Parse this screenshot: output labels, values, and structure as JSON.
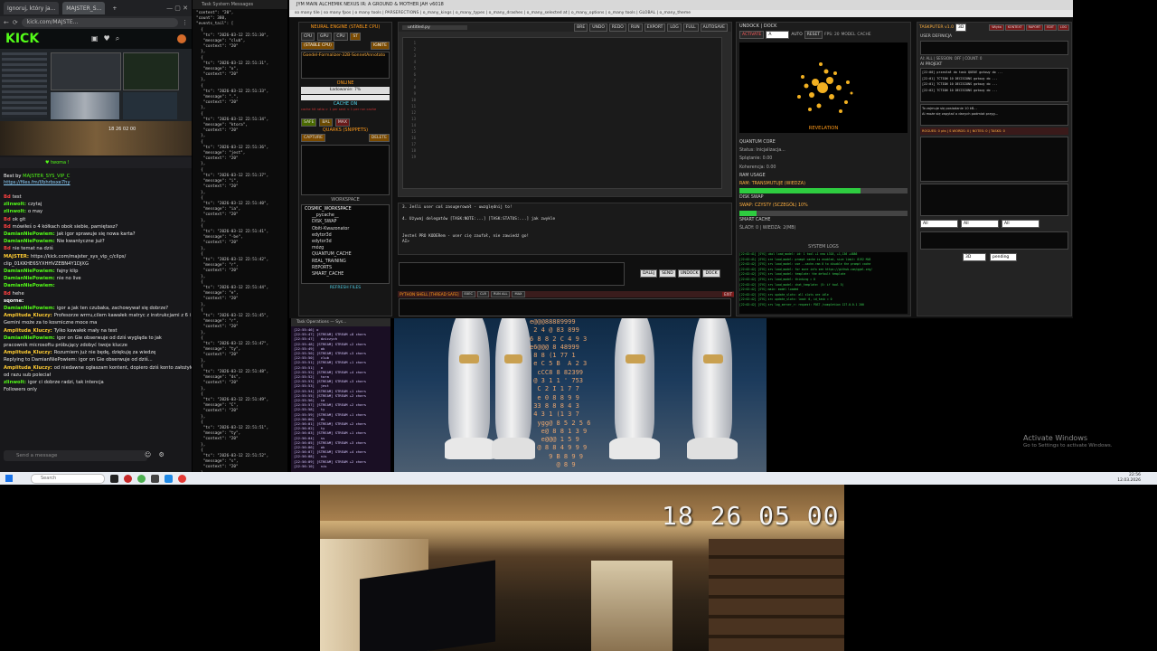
{
  "browser": {
    "tabs": [
      "Ignoruj, który ja...",
      "MAJSTER_S...",
      "+"
    ],
    "url": "kick.com/MAJSTE...",
    "logo": "KICK",
    "stream_timer": "18 26 02 00",
    "banner_user": "MAJSTER_SYS_VIP_C",
    "banner_link": "https://files.fm/f/bhrbsxe7hy",
    "chat_messages": [
      {
        "user": "Bd",
        "text": "test",
        "cls": "u2"
      },
      {
        "user": "zlinwolt:",
        "text": "czytaj",
        "cls": "u1"
      },
      {
        "user": "zlinwolt:",
        "text": "o may",
        "cls": "u1"
      },
      {
        "user": "Bd",
        "text": "ok git",
        "cls": "u2"
      },
      {
        "user": "Bd",
        "text": "mówiłeś o 4 kółkach obok siebie, pamiętasz?",
        "cls": "u2"
      },
      {
        "user": "DamianNiePowiem:",
        "text": "jak igor sprawuje się nowa karta?",
        "cls": "u1"
      },
      {
        "user": "DamianNiePowiem:",
        "text": "Nie kwantyczne już?",
        "cls": "u1"
      },
      {
        "user": "Bd",
        "text": "nie temat na dziś",
        "cls": "u2"
      },
      {
        "user": "MAJSTER:",
        "text": "https://kick.com/majster_sys_vip_c/clips/",
        "cls": "u3"
      },
      {
        "user": "",
        "text": "clip_01KKHE6SYXHHVZEBN4Y1DJXG",
        "cls": "u4"
      },
      {
        "user": "DamianNiePowiem:",
        "text": "fajny klip",
        "cls": "u1"
      },
      {
        "user": "DamianNiePowiem:",
        "text": "nie no live",
        "cls": "u1"
      },
      {
        "user": "DamianNiePowiem:",
        "text": "",
        "cls": "u1"
      },
      {
        "user": "Bd",
        "text": "hehe",
        "cls": "u2"
      },
      {
        "user": "sqorne:",
        "text": "",
        "cls": "u5"
      },
      {
        "user": "DamianNiePowiem:",
        "text": "igor a jak ten czubaka, zachowywał się dobrze?",
        "cls": "u1"
      },
      {
        "user": "Amplituda_Kluczy:",
        "text": "Profesorze wrrru,cilem kawałek matryc z instrukcjami z 6 i 8 i",
        "cls": "u3"
      },
      {
        "user": "",
        "text": "Gemini może za to kosmiczne moce ma",
        "cls": "u5"
      },
      {
        "user": "Amplituda_Kluczy:",
        "text": "Tylko kawałek mały na test",
        "cls": "u3"
      },
      {
        "user": "DamianNiePowiem:",
        "text": "igor on Gie obserwuje od dziś wygląda to jak",
        "cls": "u1"
      },
      {
        "user": "",
        "text": "pracownik microsoftu próbujący zdobyć twoje klucze",
        "cls": "u5"
      },
      {
        "user": "Amplituda_Kluczy:",
        "text": "Rozumiem już nie będę, dziękuję za wiedzę",
        "cls": "u3"
      },
      {
        "user": "",
        "text": "Replying to DamianNiePowiem: igor on Gie obserwuje od dziś...",
        "cls": "u5"
      },
      {
        "user": "Amplituda_Kluczy:",
        "text": "od niedawne ogłaszam kontent, dopiero dziś konto założyłem i",
        "cls": "u3"
      },
      {
        "user": "",
        "text": "od razu sub poleciał",
        "cls": "u5"
      },
      {
        "user": "zlinwolt:",
        "text": "igor ci dobrze radzi, tak intencja",
        "cls": "u1"
      },
      {
        "user": "",
        "text": "Followers only",
        "cls": "u5"
      }
    ],
    "chat_placeholder": "Send a message"
  },
  "json_window": {
    "title": "Task System Messages",
    "content": "\"content\": \"20\",\n\"count\": 380,\n\"events_tail\": [\n  {\n   \"ts\": \"2026-03-12 22:51:30\",\n   \"message\": \"club\",\n   \"context\": \"20\"\n  },\n  {\n   \"ts\": \"2026-03-12 22:51:31\",\n   \"message\": \"o\",\n   \"context\": \"20\"\n  },\n  {\n   \"ts\": \"2026-03-12 22:51:33\",\n   \"message\": \".\",\n   \"context\": \"20\"\n  },\n  {\n   \"ts\": \"2026-03-12 22:51:34\",\n   \"message\": \"ktora\",\n   \"context\": \"20\"\n  },\n  {\n   \"ts\": \"2026-03-12 22:51:36\",\n   \"message\": \"jest\",\n   \"context\": \"20\"\n  },\n  {\n   \"ts\": \"2026-03-12 22:51:37\",\n   \"message\": \"i\",\n   \"context\": \"20\"\n  },\n  {\n   \"ts\": \"2026-03-12 22:51:40\",\n   \"message\": \"ia\",\n   \"context\": \"20\"\n  },\n  {\n   \"ts\": \"2026-03-12 22:51:41\",\n   \"message\": \"-be\",\n   \"context\": \"20\"\n  },\n  {\n   \"ts\": \"2026-03-12 22:51:42\",\n   \"message\": \"r\",\n   \"context\": \"20\"\n  },\n  {\n   \"ts\": \"2026-03-12 22:51:44\",\n   \"message\": \"e\",\n   \"context\": \"20\"\n  },\n  {\n   \"ts\": \"2026-03-12 22:51:45\",\n   \"message\": \"r\",\n   \"context\": \"20\"\n  },\n  {\n   \"ts\": \"2026-03-12 22:51:47\",\n   \"message\": \"ty\",\n   \"context\": \"20\"\n  },\n  {\n   \"ts\": \"2026-03-12 22:51:48\",\n   \"message\": \"ds\",\n   \"context\": \"20\"\n  },\n  {\n   \"ts\": \"2026-03-12 22:51:49\",\n   \"message\": \"C\",\n   \"context\": \"20\"\n  },\n  {\n   \"ts\": \"2026-03-12 22:51:51\",\n   \"message\": \"ty\",\n   \"context\": \"20\"\n  },\n  {\n   \"ts\": \"2026-03-12 22:51:52\",\n   \"message\": \"s\",\n   \"context\": \"20\"\n  },\n  {\n   \"ts\": \"2026-03-12 22:51:53\",\n   \"message\": \"o\",\n   \"context\": \"20\"\n  },\n  {\n   \"ts\": \"2026-03-12 22:51:55\",\n   \"message\": \"k\",\n   \"context\": \"20\"\n  }\n"
  },
  "app": {
    "title": "JYM MAIN ALCHEMIK NEXUS IR: A GROUND & MOTHER JAH v6018",
    "menu": "so many tile | so many fpos | o many tools | PARSERECTIONS | o_many_kings | o_many_types | o_many_drashes | o_many_selected at | o_many_options | o_many tools | GLOBAL | o_many_theme",
    "neural_engine": {
      "header": "NEURAL ENGINE (STABLE CPU)",
      "tags": [
        "CPU",
        "GPU",
        "CPU",
        "ST"
      ],
      "stable": "(STABLE CPU)",
      "ignite": "IGNITE",
      "model": "Goedel-Formalizer-32B-SonnetAnnotato",
      "online": "ONLINE",
      "loading": "Ładowanie: 7%",
      "cache": "CACHE ON",
      "cache_note": "cache hit ratio > 1 per sent < 1 per run cache",
      "safe": "SAFE",
      "bal": "BAL",
      "max": "MAX",
      "quarks": "QUARKS (SNIPPETS)",
      "capture": "CAPTURE",
      "delete": "DELETE",
      "workspace": "WORKSPACE",
      "tree": [
        "COSMIC_WORKSPACE",
        "__pycache__",
        "DISK_SWAP",
        "Obiti-Kwazonator",
        "edytor3d",
        "edytor3d",
        "mózg",
        "QUANTUM_CACHE",
        "REAL_TRAINING",
        "REPORTS",
        "SMART_CACHE"
      ],
      "refresh": "REFRESH FILES"
    },
    "editor": {
      "tab": "untitled.py",
      "toolbar": [
        "BRE",
        "UNDO",
        "REDO",
        "RUN",
        "EXPORT",
        "LOG",
        "FULL",
        "AUTOSAVE"
      ],
      "line_numbers": [
        "1",
        "2",
        "3",
        "4",
        "5",
        "6",
        "7",
        "8",
        "9",
        "10",
        "11",
        "12",
        "13",
        "14",
        "15",
        "16",
        "17",
        "18",
        "19"
      ]
    },
    "prompt": {
      "lines": [
        "3. Jeśli user coś zasugerował - uwzględnij to!",
        "",
        "4. Używaj delegatów [TASK:NOTE:...] [TASK:STATUS:...] jak zwykle",
        "",
        "",
        "Jesteś PRO KODERem - user cię zaufał, nie zawiedź go!",
        "AI>"
      ],
      "buttons": [
        "DALEJ",
        "SEND",
        "UNDOCK",
        "DOCK"
      ]
    },
    "python_shell": {
      "label": "PYTHON SHELL [THREAD SAFE]",
      "buttons": [
        "EXEC",
        "CLR",
        "RUN ALL",
        "MAX",
        "EXIT"
      ],
      "exit": "EXIT"
    },
    "viz": {
      "undock": "UNDOCK",
      "dock": "DOCK",
      "activate": "ACTIVATE",
      "letter": "A",
      "auto": "AUTO",
      "reset": "RESET",
      "fps": "FPS: 20",
      "modes": [
        "MODEL",
        "CACHE"
      ],
      "revelation": "REVELATION",
      "quantum_core": "QUANTUM CORE",
      "status": "Status: Inicjalizacja...",
      "stat1": "Splątanie: 0.00",
      "stat2": "Koherencja: 0.00",
      "ram_usage": "RAM USAGE",
      "ram_label": "RAM: TRANSMUTUJE (WIEDZA)",
      "ram_fill": 0.72,
      "disk_swap": "DISK SWAP",
      "swap_label": "SWAP: CZYSTY (SCZEGÓŁ) 10%",
      "swap_fill": 0.1,
      "smart_cache": "SMART CACHE",
      "cache_line": "ŚLADY: 0 | WIEDZA: 2(MB)",
      "system_logs": "SYSTEM LOGS",
      "logs": [
        "[22:02:41] [SYS] ukol  load_model: id: 1 tool +1 new i318, +1,136 +4886",
        "[22:02:41] [SYS] sre   load_model: prompt cache is enabled, size limit: 8192 MiB",
        "[22:02:42] [SYS] srv   load_model: use --cache-ram 0 to disable the prompt cache",
        "[22:02:42] [SYS] srv   load_model: for more info see https://github.com/ggml-org/",
        "[22:02:42] [SYS] srv   load_model: template: the default template",
        "[22:02:42] [SYS] srv   load_model: thinking = 0",
        "[22:02:42] [SYS] srv   load_model: chat_template: (5: if tool 5)",
        "[22:02:42] [SYS] main: model loaded",
        "[22:02:42] [SYS] srv   update_slots: all slots are idle",
        "[22:02:42] [SYS] src   update_slots: load: 0, id_task = 0",
        "[22:02:42] [SYS] srv   log_server_r: request: POST /completion 127.0.0.1 200"
      ]
    },
    "taskputer": {
      "title": "TASKPUTER v1.0",
      "mode": "3D",
      "top_buttons": [
        "Wtyka",
        "KONTEXT",
        "RAPORT",
        "EDIT",
        "LOG"
      ],
      "user_section": "USER DEFINICJA",
      "ai_section": "AI PROJEKT",
      "table_rows": [
        "[22:00] przesłał do task QUEUE gotowy do ...",
        "[22:01] TCTION 10 DECISIONS gotowy do ...",
        "[22:01] TCTION 10 DECISIONS gotowy do ...",
        "[22:02] TCTION 10 DECISIONS gotowy do ..."
      ],
      "notes": [
        "To zajmuje się posiadanie 10 kB...",
        "Ai może się zapytać o danych podmiot przyg..."
      ],
      "counters": "ROGUES: 0 pts | S WORDS: 0 | NOTES: 0 | TASKS: 0",
      "selects": [
        "All",
        "All",
        "All"
      ],
      "bottom": [
        "3D",
        "pending"
      ],
      "stats_line": "AI: ALL | SESSION: OFF | COUNT: 0"
    }
  },
  "terminal": {
    "title": "Task Operations — Sys...",
    "lines": [
      "[22:55:46] o",
      "[22:55:47] [STREAM] STREAM +8 chars",
      "[22:55:47]   dziczych",
      "[22:55:48] [STREAM] STREAM +2 chars",
      "[22:55:49]   ok",
      "[22:55:50] [STREAM] STREAM +3 chars",
      "[22:55:50]   club",
      "[22:55:51] [STREAM] STREAM +1 chars",
      "[22:55:51]   o",
      "[22:55:52] [STREAM] STREAM +4 chars",
      "[22:55:52]   tora",
      "[22:55:53] [STREAM] STREAM +3 chars",
      "[22:55:53]   jest",
      "[22:55:54] [STREAM] STREAM +1 chars",
      "[22:55:55] [STREAM] STREAM +2 chars",
      "[22:55:56]   ia",
      "[22:55:57] [STREAM] STREAM +2 chars",
      "[22:55:58]   ty",
      "[22:55:59] [STREAM] STREAM +1 chars",
      "[22:56:00]   ds",
      "[22:56:01] [STREAM] STREAM +2 chars",
      "[22:56:02]   ty",
      "[22:56:03] [STREAM] STREAM +1 chars",
      "[22:56:04]   ss",
      "[22:56:05] [STREAM] STREAM +3 chars",
      "[22:56:06]   ok",
      "[22:56:07] [STREAM] STREAM +4 chars",
      "[22:56:08]   nis",
      "[22:56:09] [STREAM] STREAM +2 chars",
      "[22:56:10]   nis"
    ]
  },
  "matrix_text": "e@@@88889999\n 2 4 @ 83 899\n6 8 8 2 C 4 9 3\ne6@@@ 8 48999\n 8 8 (1 77 1\n e C 5 B  A 2 3\n  cCC8 8 82399\n @ 3 1 1 ' 753\n  C 2 I 1 7 7\n  e 0 8 8 9 9\n 33 8 8 8 4 3\n 4 3 1 (1 3 7\n  ygg@ 8 5 2 5 6\n   e@ 8 8 1 3 9\n   e@@@ 1 5 9\n  @ 8 8 4 9 9 9\n     9 B 8 9 9\n       @ 8 9",
  "windows_watermark": {
    "line1": "Activate Windows",
    "line2": "Go to Settings to activate Windows."
  },
  "taskbar": {
    "search": "Search",
    "time": "22:56",
    "date": "12.03.2026"
  },
  "webcam": {
    "timestamp": "18 26 05 00"
  }
}
